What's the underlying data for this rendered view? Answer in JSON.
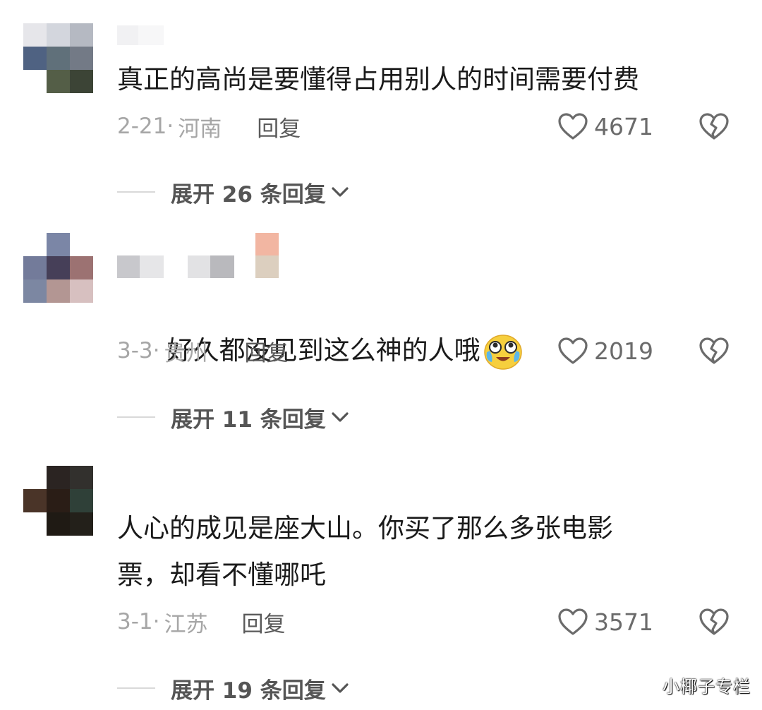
{
  "comments": [
    {
      "text": "真正的高尚是要懂得占用别人的时间需要付费",
      "date": "2-21",
      "region": "河南",
      "reply_label": "回复",
      "likes": "4671",
      "expand_label": "展开 26 条回复",
      "avatar_colors": [
        "#e6e6ea",
        "#d3d6dd",
        "#b5b9c2",
        "#4f6282",
        "#60707a",
        "#737a86",
        "#ffffff",
        "#545e47",
        "#3c4436"
      ]
    },
    {
      "text": "好久都没见到这么神的人哦",
      "date": "3-3",
      "region": "贵州",
      "reply_label": "回复",
      "likes": "2019",
      "expand_label": "展开 11 条回复",
      "avatar_colors": [
        "#ffffff",
        "#7b86a6",
        "#ffffff",
        "#737b9a",
        "#463f58",
        "#9c7272",
        "#7c87a2",
        "#b39693",
        "#d7c0c0"
      ]
    },
    {
      "text": "人心的成见是座大山。你买了那么多张电影\n票，却看不懂哪吒",
      "date": "3-1",
      "region": "江苏",
      "reply_label": "回复",
      "likes": "3571",
      "expand_label": "展开 19 条回复",
      "avatar_colors": [
        "#ffffff",
        "#2b2422",
        "#32302d",
        "#4a3428",
        "#2a1d16",
        "#2f4038",
        "#ffffff",
        "#1f1a14",
        "#23201a"
      ]
    }
  ],
  "icons": {
    "heart": "heart-outline-icon",
    "dislike": "broken-heart-icon",
    "chevron": "chevron-down-icon",
    "emoji": "crying-laughing-emoji"
  },
  "watermark": "小椰子专栏"
}
